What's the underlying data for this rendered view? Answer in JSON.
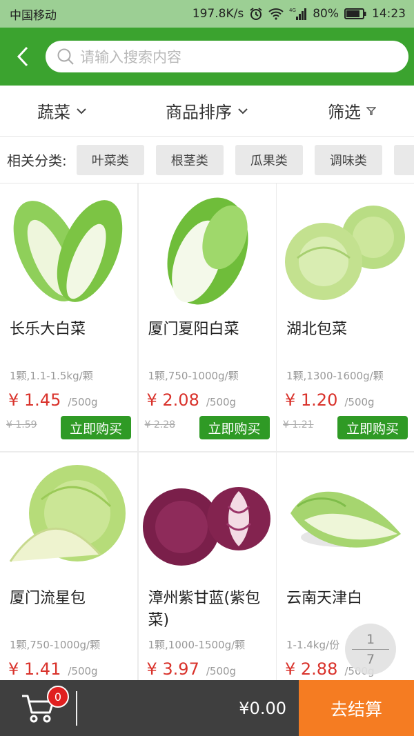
{
  "status_bar": {
    "carrier": "中国移动",
    "speed": "197.8K/s",
    "network": "4G",
    "battery": "80%",
    "time": "14:23"
  },
  "header": {
    "search_placeholder": "请输入搜索内容"
  },
  "filters": {
    "category": "蔬菜",
    "sort": "商品排序",
    "filter": "筛选"
  },
  "related": {
    "label": "相关分类:",
    "chips": [
      "叶菜类",
      "根茎类",
      "瓜果类",
      "调味类"
    ]
  },
  "products": [
    {
      "name": "长乐大白菜",
      "spec": "1颗,1.1-1.5kg/颗",
      "price": "¥ 1.45",
      "unit": "/500g",
      "orig": "¥ 1.59",
      "buy": "立即购买"
    },
    {
      "name": "厦门夏阳白菜",
      "spec": "1颗,750-1000g/颗",
      "price": "¥ 2.08",
      "unit": "/500g",
      "orig": "¥ 2.28",
      "buy": "立即购买"
    },
    {
      "name": "湖北包菜",
      "spec": "1颗,1300-1600g/颗",
      "price": "¥ 1.20",
      "unit": "/500g",
      "orig": "¥ 1.21",
      "buy": "立即购买"
    },
    {
      "name": "厦门流星包",
      "spec": "1颗,750-1000g/颗",
      "price": "¥ 1.41",
      "unit": "/500g",
      "orig": "",
      "buy": ""
    },
    {
      "name": "漳州紫甘蓝(紫包菜)",
      "spec": "1颗,1000-1500g/颗",
      "price": "¥ 3.97",
      "unit": "/500g",
      "orig": "",
      "buy": ""
    },
    {
      "name": "云南天津白",
      "spec": "1-1.4kg/份",
      "price": "¥ 2.88",
      "unit": "/500g",
      "orig": "",
      "buy": ""
    }
  ],
  "pager": {
    "current": "1",
    "total": "7"
  },
  "bottom": {
    "cart_count": "0",
    "total": "¥0.00",
    "checkout": "去结算"
  },
  "colors": {
    "brand_green": "#3ba32f",
    "price_red": "#d9322b",
    "checkout_orange": "#f57c22"
  }
}
